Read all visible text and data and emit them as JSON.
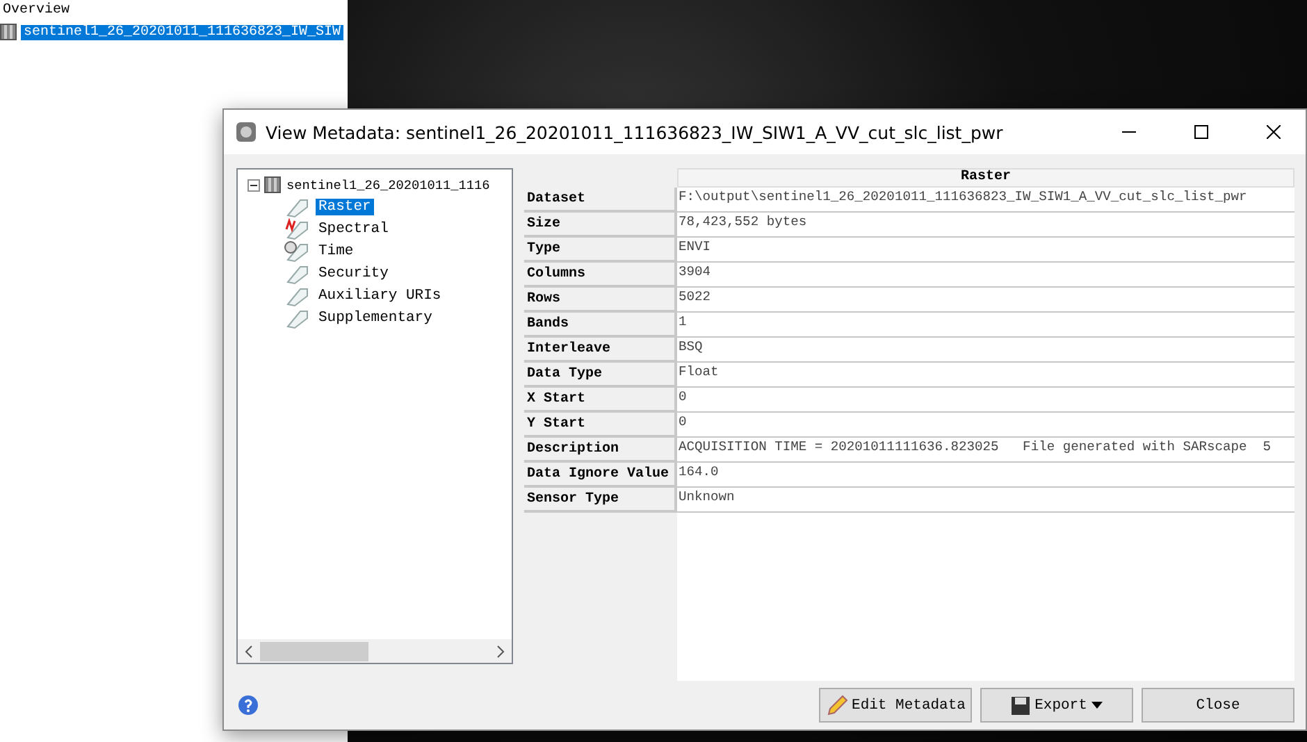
{
  "background_panel": {
    "items": [
      {
        "label": "Overview",
        "selected": false
      },
      {
        "label": "sentinel1_26_20201011_111636823_IW_SIW",
        "selected": true
      }
    ]
  },
  "dialog": {
    "title": "View Metadata: sentinel1_26_20201011_111636823_IW_SIW1_A_VV_cut_slc_list_pwr",
    "tree": {
      "label": "sentinel1_26_20201011_1116",
      "expanded": true,
      "children": [
        {
          "label": "Raster",
          "kind": "tag",
          "selected": true
        },
        {
          "label": "Spectral",
          "kind": "spectral",
          "selected": false
        },
        {
          "label": "Time",
          "kind": "time",
          "selected": false
        },
        {
          "label": "Security",
          "kind": "tag",
          "selected": false
        },
        {
          "label": "Auxiliary URIs",
          "kind": "tag",
          "selected": false
        },
        {
          "label": "Supplementary",
          "kind": "tag",
          "selected": false
        }
      ]
    },
    "table": {
      "header": "Raster",
      "rows": [
        {
          "label": "Dataset",
          "value": "F:\\output\\sentinel1_26_20201011_111636823_IW_SIW1_A_VV_cut_slc_list_pwr"
        },
        {
          "label": "Size",
          "value": "78,423,552 bytes"
        },
        {
          "label": "Type",
          "value": "ENVI"
        },
        {
          "label": "Columns",
          "value": "3904"
        },
        {
          "label": "Rows",
          "value": "5022"
        },
        {
          "label": "Bands",
          "value": "1"
        },
        {
          "label": "Interleave",
          "value": "BSQ"
        },
        {
          "label": "Data Type",
          "value": "Float"
        },
        {
          "label": "X Start",
          "value": "0"
        },
        {
          "label": "Y Start",
          "value": "0"
        },
        {
          "label": "Description",
          "value": "ACQUISITION TIME = 20201011111636.823025   File generated with SARscape  5"
        },
        {
          "label": "Data Ignore Value",
          "value": "164.0"
        },
        {
          "label": "Sensor Type",
          "value": "Unknown"
        }
      ]
    },
    "buttons": [
      {
        "label": "Edit Metadata",
        "kind": "edit"
      },
      {
        "label": "Export",
        "kind": "export"
      },
      {
        "label": "Close",
        "kind": "close"
      }
    ]
  }
}
